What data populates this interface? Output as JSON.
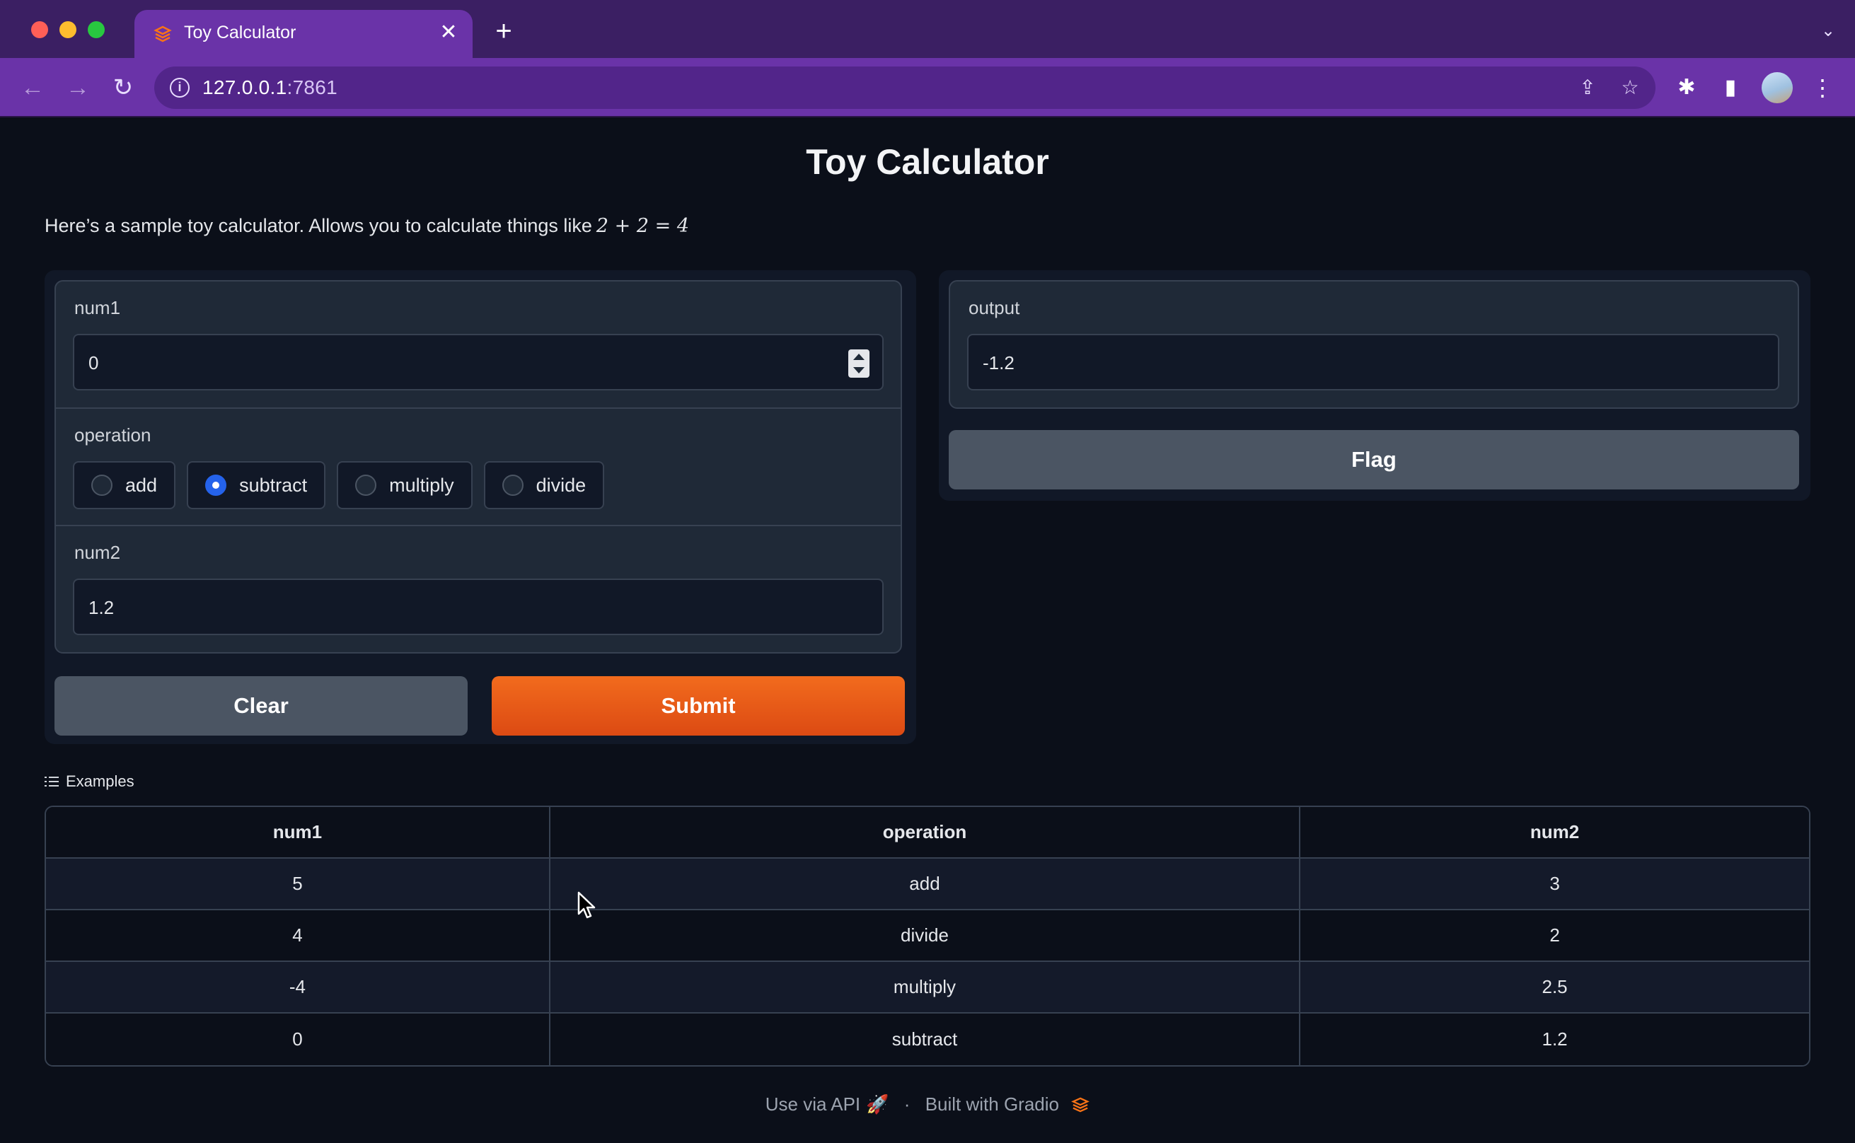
{
  "browser": {
    "tab_title": "Toy Calculator",
    "tab_close": "✕",
    "new_tab": "+",
    "url": "127.0.0.1",
    "url_port": ":7861"
  },
  "page": {
    "title": "Toy Calculator",
    "description": "Here’s a sample toy calculator. Allows you to calculate things like",
    "description_math": "2 + 2 = 4"
  },
  "inputs": {
    "num1": {
      "label": "num1",
      "value": "0"
    },
    "operation": {
      "label": "operation",
      "options": [
        "add",
        "subtract",
        "multiply",
        "divide"
      ],
      "selected": "subtract"
    },
    "num2": {
      "label": "num2",
      "value": "1.2"
    }
  },
  "buttons": {
    "clear": "Clear",
    "submit": "Submit",
    "flag": "Flag"
  },
  "output": {
    "label": "output",
    "value": "-1.2"
  },
  "examples": {
    "heading": "Examples",
    "headers": [
      "num1",
      "operation",
      "num2"
    ],
    "rows": [
      [
        "5",
        "add",
        "3"
      ],
      [
        "4",
        "divide",
        "2"
      ],
      [
        "-4",
        "multiply",
        "2.5"
      ],
      [
        "0",
        "subtract",
        "1.2"
      ]
    ]
  },
  "footer": {
    "api": "Use via API",
    "separator": "·",
    "built": "Built with Gradio"
  },
  "colors": {
    "accent": "#f26b1d",
    "radio_selected": "#2563eb",
    "chrome": "#6a33a8"
  }
}
